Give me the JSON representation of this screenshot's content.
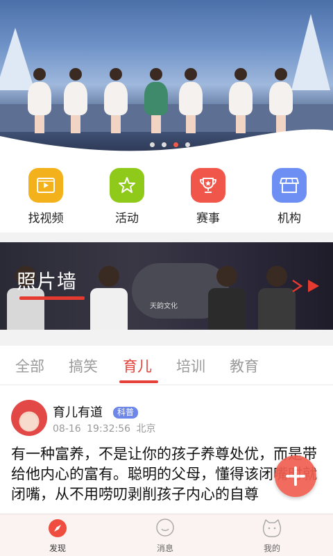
{
  "banner": {
    "slide_count": 4,
    "active_slide": 3
  },
  "quick_nav": [
    {
      "label": "找视频",
      "icon": "video-icon",
      "color": "#f3b21b"
    },
    {
      "label": "活动",
      "icon": "star-icon",
      "color": "#8fc91a"
    },
    {
      "label": "赛事",
      "icon": "trophy-icon",
      "color": "#f0574a"
    },
    {
      "label": "机构",
      "icon": "shop-icon",
      "color": "#6d8ef3"
    }
  ],
  "photo_wall": {
    "title": "照片墙",
    "accent": "#e53a2f",
    "drum_text": "天韵文化"
  },
  "tabs": [
    {
      "label": "全部"
    },
    {
      "label": "搞笑"
    },
    {
      "label": "育儿",
      "active": true
    },
    {
      "label": "培训"
    },
    {
      "label": "教育"
    }
  ],
  "post": {
    "author": "育儿有道",
    "badge": "科普",
    "date": "08-16",
    "time": "19:32:56",
    "location": "北京",
    "text": "有一种富养，不是让你的孩子养尊处优，而是带给他内心的富有。聪明的父母，懂得该闭嘴时就闭嘴，从不用唠叨剥削孩子内心的自尊"
  },
  "bottom_nav": [
    {
      "label": "发现",
      "icon": "compass-icon",
      "active": true
    },
    {
      "label": "消息",
      "icon": "chat-icon"
    },
    {
      "label": "我的",
      "icon": "cat-face-icon"
    }
  ],
  "colors": {
    "accent": "#e5413a",
    "fab": "#f06051"
  }
}
